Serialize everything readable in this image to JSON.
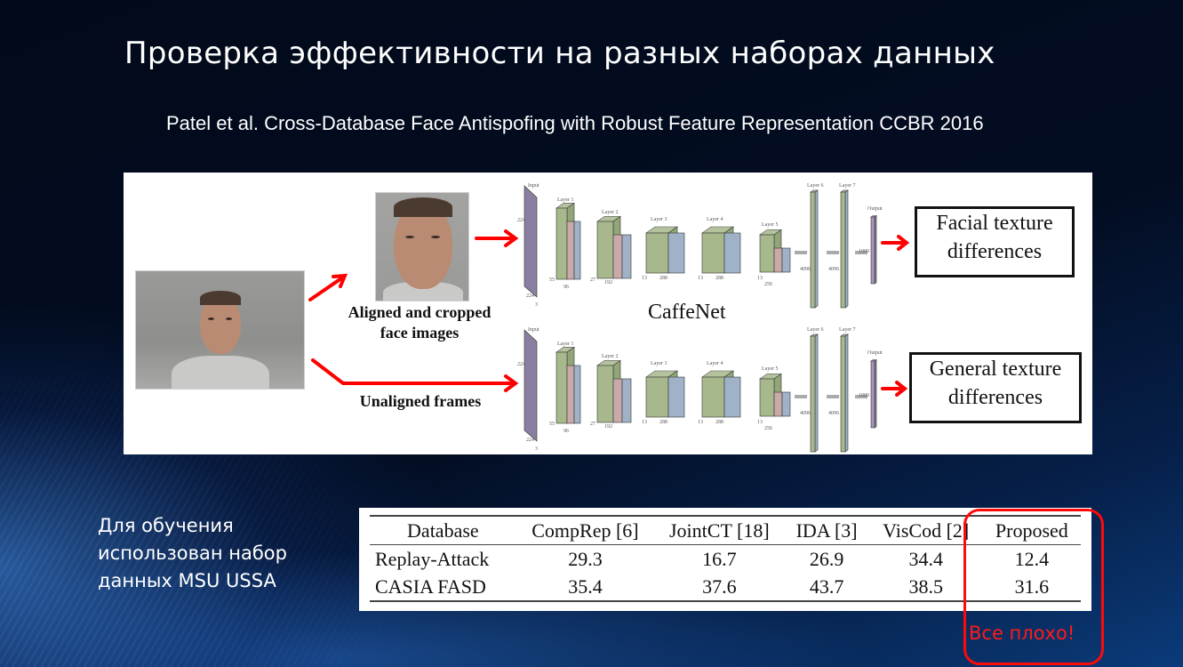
{
  "slide": {
    "title": "Проверка эффективности на разных наборах данных",
    "reference": "Patel et al. Cross-Database Face Antispofing with Robust Feature Representation CCBR 2016",
    "note_lines": [
      "Для обучения",
      "использован набор",
      "данных MSU USSA"
    ],
    "highlight_label": "Все плохо!"
  },
  "figure": {
    "aligned_label": [
      "Aligned and cropped",
      "face images"
    ],
    "unaligned_label": "Unaligned frames",
    "network_name": "CaffeNet",
    "network_layers": [
      "Input",
      "Layer 1",
      "Layer 2",
      "Layer 3",
      "Layer 4",
      "Layer 5",
      "Layer 6",
      "Layer 7",
      "Output"
    ],
    "network_dims": {
      "input": [
        "224",
        "224",
        "3"
      ],
      "layer1": [
        "55",
        "96"
      ],
      "layer2": [
        "27",
        "192"
      ],
      "layer3": [
        "13",
        "288"
      ],
      "layer4": [
        "13",
        "288"
      ],
      "layer5": [
        "13",
        "256"
      ],
      "fc6": "4096",
      "fc7": "4096",
      "output": "1000"
    },
    "output_top": [
      "Facial texture",
      "differences"
    ],
    "output_bottom": [
      "General texture",
      "differences"
    ],
    "arrow_color": "#ff0000"
  },
  "results_table": {
    "headers": [
      "Database",
      "CompRep [6]",
      "JointCT [18]",
      "IDA [3]",
      "VisCod [2]",
      "Proposed"
    ],
    "rows": [
      [
        "Replay-Attack",
        "29.3",
        "16.7",
        "26.9",
        "34.4",
        "12.4"
      ],
      [
        "CASIA FASD",
        "35.4",
        "37.6",
        "43.7",
        "38.5",
        "31.6"
      ]
    ]
  },
  "colors": {
    "highlight": "#ff0a0a",
    "background": "#020b1c",
    "text": "#ffffff"
  }
}
